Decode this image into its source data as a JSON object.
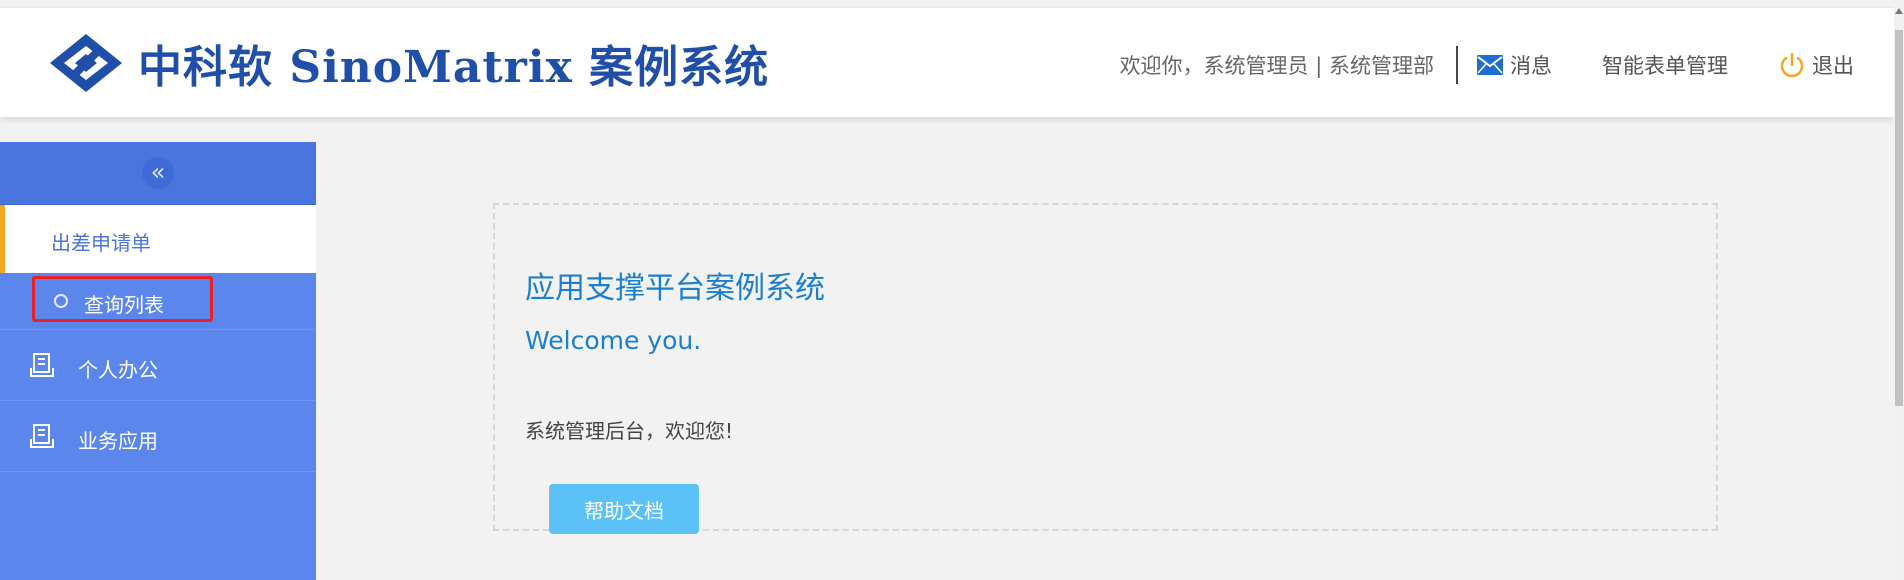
{
  "header": {
    "logo_text": "中科软 SinoMatrix 案例系统",
    "welcome_text": "欢迎你，系统管理员 | 系统管理部",
    "message_label": "消息",
    "form_manage_label": "智能表单管理",
    "logout_label": "退出",
    "colors": {
      "brand": "#1f4fa8",
      "logout_icon": "#f5a623",
      "message_icon": "#1f6fd0"
    }
  },
  "sidebar": {
    "collapse_icon": "double-chevron-left-icon",
    "active_item": {
      "label": "出差申请单"
    },
    "sub_items": [
      {
        "label": "查询列表",
        "icon": "circle-icon"
      }
    ],
    "items": [
      {
        "label": "个人办公",
        "icon": "folder-stack-icon"
      },
      {
        "label": "业务应用",
        "icon": "folder-stack-icon"
      }
    ],
    "colors": {
      "background": "#5b86ec",
      "active_accent": "#f5a623"
    }
  },
  "main": {
    "title": "应用支撑平台案例系统",
    "welcome": "Welcome you.",
    "description": "系统管理后台，欢迎您!",
    "help_button": "帮助文档"
  }
}
